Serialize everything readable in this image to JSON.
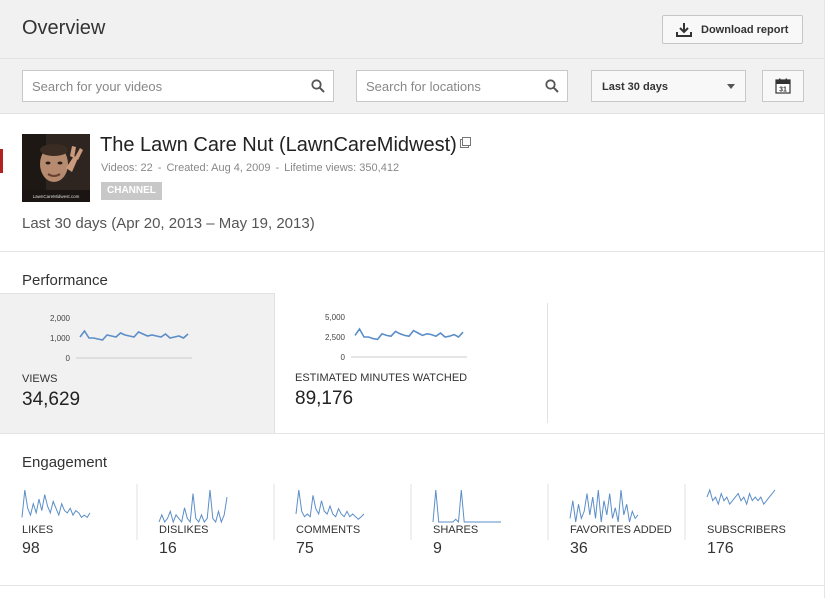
{
  "header": {
    "title": "Overview",
    "download_label": "Download report"
  },
  "toolbar": {
    "video_search_placeholder": "Search for your videos",
    "location_search_placeholder": "Search for locations",
    "date_range_selected": "Last 30 days",
    "calendar_day": "31"
  },
  "channel": {
    "name": "The Lawn Care Nut (LawnCareMidwest)",
    "videos": "Videos: 22",
    "created": "Created: Aug 4, 2009",
    "lifetime_views": "Lifetime views: 350,412",
    "badge": "CHANNEL",
    "thumbnail_caption": "LawnCareMidwest.com"
  },
  "date_range_text": "Last 30 days (Apr 20, 2013 – May 19, 2013)",
  "performance": {
    "title": "Performance",
    "views": {
      "label": "VIEWS",
      "value": "34,629",
      "ticks": [
        "2,000",
        "1,000",
        "0"
      ],
      "ymax": 2000,
      "series": [
        1050,
        1350,
        1000,
        1000,
        950,
        900,
        1150,
        1100,
        1050,
        1250,
        1150,
        1100,
        1050,
        1300,
        1200,
        1100,
        1150,
        1100,
        1050,
        1200,
        1000,
        1050,
        1100,
        1000,
        1200
      ]
    },
    "minutes": {
      "label": "ESTIMATED MINUTES WATCHED",
      "value": "89,176",
      "ticks": [
        "5,000",
        "2,500",
        "0"
      ],
      "ymax": 5000,
      "series": [
        2700,
        3500,
        2500,
        2500,
        2300,
        2200,
        2900,
        2700,
        2600,
        3200,
        2900,
        2700,
        2600,
        3300,
        3000,
        2700,
        2900,
        2800,
        2600,
        3000,
        2500,
        2600,
        2800,
        2500,
        3100
      ]
    }
  },
  "engagement": {
    "title": "Engagement",
    "metrics": [
      {
        "label": "LIKES",
        "value": "98",
        "series": [
          2,
          14,
          6,
          3,
          8,
          4,
          10,
          5,
          12,
          7,
          4,
          9,
          6,
          3,
          8,
          5,
          4,
          6,
          3,
          5,
          4,
          2,
          3,
          2,
          4
        ]
      },
      {
        "label": "DISLIKES",
        "value": "16",
        "series": [
          0,
          2,
          0,
          1,
          3,
          0,
          2,
          1,
          0,
          4,
          1,
          0,
          8,
          1,
          0,
          2,
          0,
          1,
          9,
          1,
          0,
          3,
          0,
          2,
          7
        ]
      },
      {
        "label": "COMMENTS",
        "value": "75",
        "series": [
          3,
          12,
          4,
          2,
          3,
          2,
          10,
          5,
          3,
          8,
          4,
          3,
          6,
          3,
          2,
          5,
          3,
          2,
          4,
          2,
          3,
          2,
          1,
          2,
          3
        ]
      },
      {
        "label": "SHARES",
        "value": "9",
        "series": [
          0,
          12,
          0,
          0,
          0,
          0,
          0,
          0,
          1,
          0,
          12,
          0,
          0,
          0,
          0,
          0,
          0,
          0,
          0,
          0,
          0,
          0,
          0,
          0,
          0
        ]
      },
      {
        "label": "FAVORITES ADDED",
        "value": "36",
        "series": [
          1,
          6,
          0,
          5,
          1,
          3,
          8,
          2,
          7,
          1,
          9,
          0,
          6,
          2,
          8,
          1,
          4,
          0,
          9,
          2,
          5,
          0,
          3,
          1,
          2
        ]
      },
      {
        "label": "SUBSCRIBERS",
        "value": "176",
        "series": [
          7,
          9,
          6,
          7,
          5,
          8,
          6,
          7,
          5,
          6,
          7,
          8,
          6,
          7,
          5,
          8,
          6,
          7,
          6,
          7,
          5,
          6,
          7,
          8,
          9
        ]
      }
    ]
  },
  "colors": {
    "sparkline": "#5b8ec8",
    "accent_edge": "#b32222"
  }
}
